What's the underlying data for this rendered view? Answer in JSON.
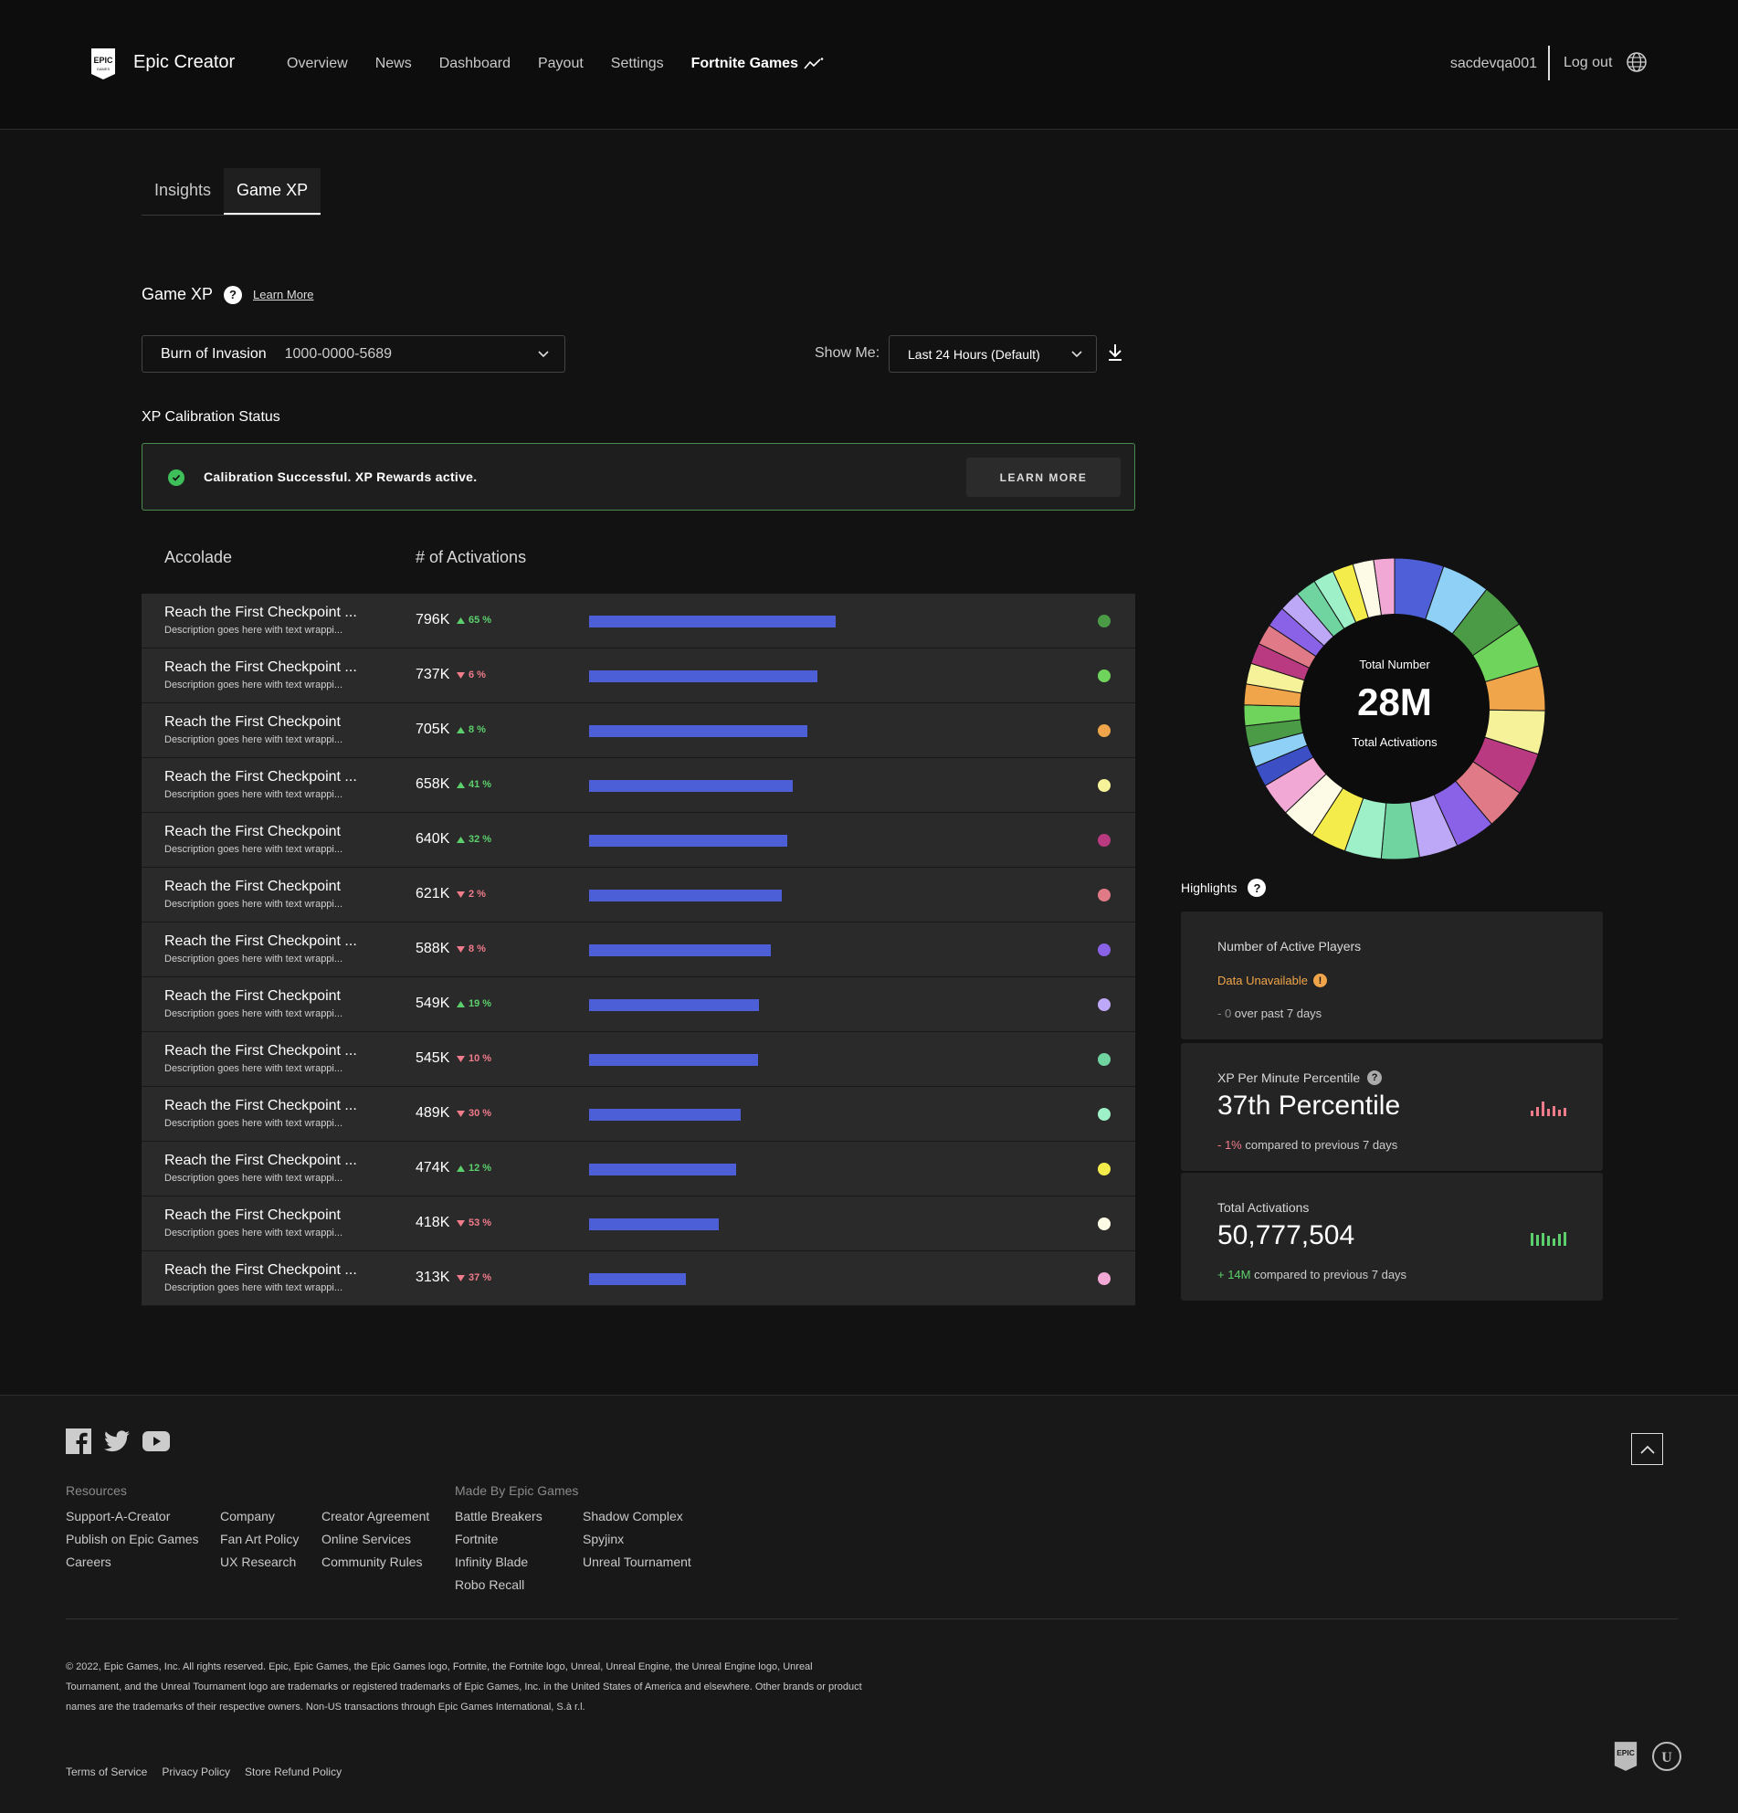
{
  "header": {
    "brand": "Epic Creator",
    "nav": [
      "Overview",
      "News",
      "Dashboard",
      "Payout",
      "Settings"
    ],
    "nav_active": "Fortnite Games",
    "username": "sacdevqa001",
    "logout": "Log out"
  },
  "tabs": [
    "Insights",
    "Game XP"
  ],
  "section": {
    "title": "Game XP",
    "learn_more": "Learn More"
  },
  "filters": {
    "game_name": "Burn of Invasion",
    "game_code": "1000-0000-5689",
    "show_me_label": "Show Me:",
    "range": "Last 24 Hours (Default)"
  },
  "calibration": {
    "title": "XP Calibration Status",
    "message": "Calibration Successful. XP Rewards active.",
    "button": "LEARN MORE"
  },
  "table": {
    "headers": [
      "Accolade",
      "# of Activations"
    ],
    "rows": [
      {
        "title": "Reach the First Checkpoint ...",
        "desc": "Description goes here with text wrappi...",
        "value": "796K",
        "change": "65 %",
        "dir": "up",
        "bar": 796,
        "color": "#4a9a46"
      },
      {
        "title": "Reach the First Checkpoint ...",
        "desc": "Description goes here with text wrappi...",
        "value": "737K",
        "change": "6 %",
        "dir": "down",
        "bar": 737,
        "color": "#6fd45c"
      },
      {
        "title": "Reach the First Checkpoint",
        "desc": "Description goes here with text wrappi...",
        "value": "705K",
        "change": "8 %",
        "dir": "up",
        "bar": 705,
        "color": "#f0a54a"
      },
      {
        "title": "Reach the First Checkpoint ...",
        "desc": "Description goes here with text wrappi...",
        "value": "658K",
        "change": "41 %",
        "dir": "up",
        "bar": 658,
        "color": "#f6f29a"
      },
      {
        "title": "Reach the First Checkpoint",
        "desc": "Description goes here with text wrappi...",
        "value": "640K",
        "change": "32 %",
        "dir": "up",
        "bar": 640,
        "color": "#b93a80"
      },
      {
        "title": "Reach the First Checkpoint",
        "desc": "Description goes here with text wrappi...",
        "value": "621K",
        "change": "2 %",
        "dir": "down",
        "bar": 621,
        "color": "#e07a86"
      },
      {
        "title": "Reach the First Checkpoint ...",
        "desc": "Description goes here with text wrappi...",
        "value": "588K",
        "change": "8 %",
        "dir": "down",
        "bar": 588,
        "color": "#8a62e8"
      },
      {
        "title": "Reach the First Checkpoint",
        "desc": "Description goes here with text wrappi...",
        "value": "549K",
        "change": "19 %",
        "dir": "up",
        "bar": 549,
        "color": "#bca8f6"
      },
      {
        "title": "Reach the First Checkpoint ...",
        "desc": "Description goes here with text wrappi...",
        "value": "545K",
        "change": "10 %",
        "dir": "down",
        "bar": 545,
        "color": "#6fd4a0"
      },
      {
        "title": "Reach the First Checkpoint ...",
        "desc": "Description goes here with text wrappi...",
        "value": "489K",
        "change": "30 %",
        "dir": "down",
        "bar": 489,
        "color": "#9df0c8"
      },
      {
        "title": "Reach the First Checkpoint ...",
        "desc": "Description goes here with text wrappi...",
        "value": "474K",
        "change": "12 %",
        "dir": "up",
        "bar": 474,
        "color": "#f4ec4a"
      },
      {
        "title": "Reach the First Checkpoint",
        "desc": "Description goes here with text wrappi...",
        "value": "418K",
        "change": "53 %",
        "dir": "down",
        "bar": 418,
        "color": "#fdfbe6"
      },
      {
        "title": "Reach the First Checkpoint ...",
        "desc": "Description goes here with text wrappi...",
        "value": "313K",
        "change": "37 %",
        "dir": "down",
        "bar": 313,
        "color": "#f2a8d4"
      }
    ]
  },
  "donut": {
    "label_top": "Total Number",
    "value": "28M",
    "label_bottom": "Total Activations",
    "colors": [
      "#4f5fd8",
      "#8fd0f6",
      "#4a9a46",
      "#6fd45c",
      "#f0a54a",
      "#f6f29a",
      "#b93a80",
      "#e07a86",
      "#8a62e8",
      "#bca8f6",
      "#6fd4a0",
      "#9df0c8",
      "#f4ec4a",
      "#fdfbe6",
      "#f2a8d4",
      "#3c4fc4",
      "#8fd0f6",
      "#4a9a46",
      "#6fd45c",
      "#f0a54a",
      "#f6f29a",
      "#b93a80",
      "#e07a86",
      "#8a62e8",
      "#bca8f6",
      "#6fd4a0",
      "#9df0c8",
      "#f4ec4a",
      "#fdfbe6",
      "#f2a8d4"
    ]
  },
  "highlights": {
    "title": "Highlights",
    "active_players": {
      "label": "Number of Active Players",
      "status": "Data Unavailable",
      "delta": "- 0",
      "period": "over past 7 days"
    },
    "xp_percentile": {
      "label": "XP Per Minute Percentile",
      "value": "37th Percentile",
      "delta": "- 1%",
      "period": "compared to previous 7 days"
    },
    "total_activations": {
      "label": "Total Activations",
      "value": "50,777,504",
      "delta": "+ 14M",
      "period": "compared to previous 7 days"
    }
  },
  "footer": {
    "resources_title": "Resources",
    "resources_col1": [
      "Support-A-Creator",
      "Publish on Epic Games",
      "Careers"
    ],
    "resources_col2": [
      "Company",
      "Fan Art Policy",
      "UX Research"
    ],
    "resources_col3": [
      "Creator Agreement",
      "Online Services",
      "Community Rules"
    ],
    "made_title": "Made By Epic Games",
    "made_col1": [
      "Battle Breakers",
      "Fortnite",
      "Infinity Blade",
      "Robo Recall"
    ],
    "made_col2": [
      "Shadow Complex",
      "Spyjinx",
      "Unreal Tournament"
    ],
    "legal": "© 2022, Epic Games, Inc. All rights reserved. Epic, Epic Games, the Epic Games logo, Fortnite, the Fortnite logo, Unreal, Unreal Engine, the Unreal Engine logo, Unreal Tournament, and the Unreal Tournament logo are trademarks or registered trademarks of Epic Games, Inc. in the United States of America and elsewhere. Other brands or product names are the trademarks of their respective owners. Non-US transactions through Epic Games International, S.à r.l.",
    "legal_links": [
      "Terms of Service",
      "Privacy Policy",
      "Store Refund Policy"
    ]
  }
}
